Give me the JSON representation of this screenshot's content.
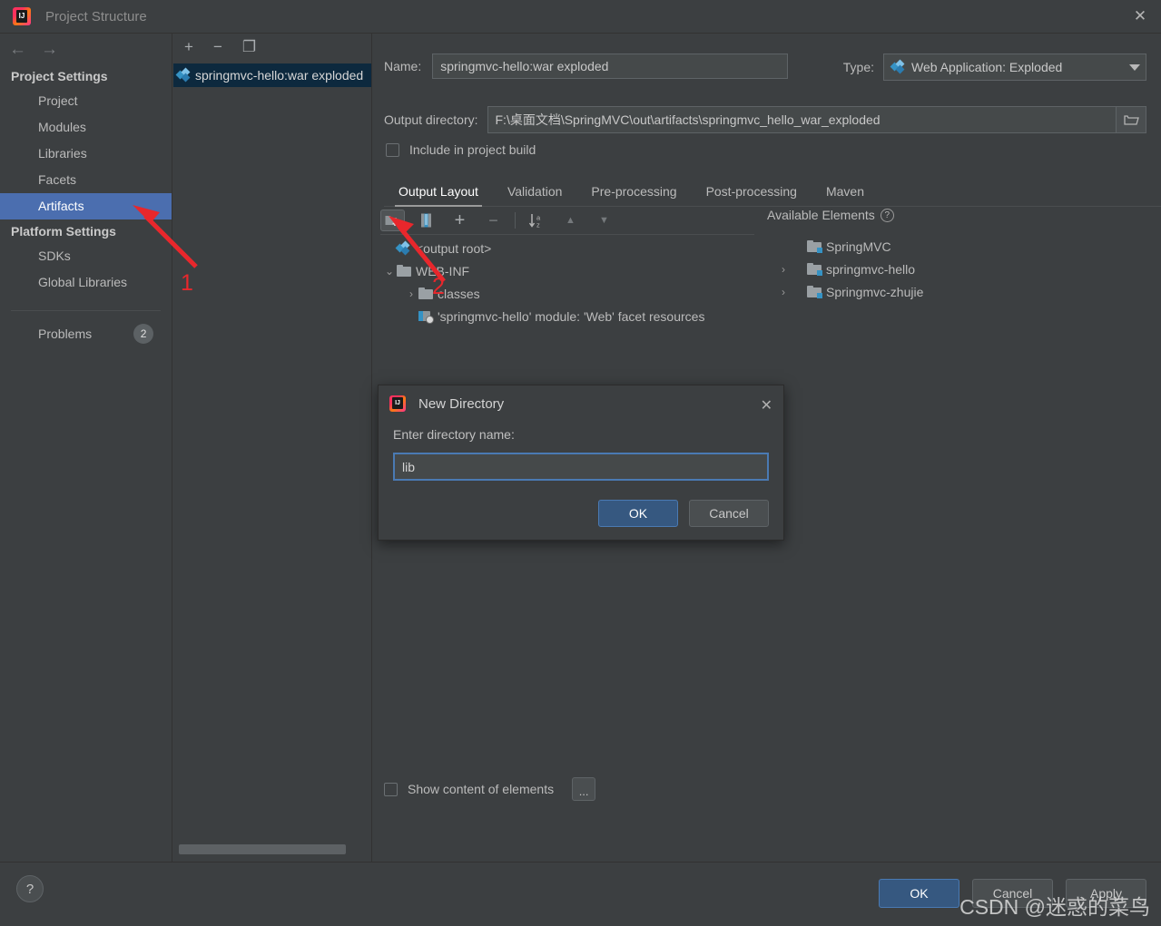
{
  "window": {
    "title": "Project Structure",
    "logo_icon": "intellij-idea-logo",
    "close_icon": "✕"
  },
  "sidebar": {
    "back_icon": "←",
    "forward_icon": "→",
    "groups": [
      {
        "title": "Project Settings",
        "items": [
          {
            "label": "Project",
            "selected": false
          },
          {
            "label": "Modules",
            "selected": false
          },
          {
            "label": "Libraries",
            "selected": false
          },
          {
            "label": "Facets",
            "selected": false
          },
          {
            "label": "Artifacts",
            "selected": true
          }
        ]
      },
      {
        "title": "Platform Settings",
        "items": [
          {
            "label": "SDKs",
            "selected": false
          },
          {
            "label": "Global Libraries",
            "selected": false
          }
        ]
      }
    ],
    "problems": {
      "label": "Problems",
      "count": "2"
    }
  },
  "artifacts_pane": {
    "toolbar": [
      {
        "name": "add-artifact-button",
        "glyph": "+"
      },
      {
        "name": "remove-artifact-button",
        "glyph": "−"
      },
      {
        "name": "copy-artifact-button",
        "glyph": "❐"
      }
    ],
    "items": [
      {
        "label": "springmvc-hello:war exploded",
        "icon": "artifact-icon",
        "selected": true
      }
    ]
  },
  "main": {
    "name_label": "Name:",
    "name_value": "springmvc-hello:war exploded",
    "type_label": "Type:",
    "type_value": "Web Application: Exploded",
    "type_icon": "web-application-icon",
    "output_dir_label": "Output directory:",
    "output_dir_value": "F:\\桌面文档\\SpringMVC\\out\\artifacts\\springmvc_hello_war_exploded",
    "browse_icon": "folder-open-icon",
    "include_in_build_label": "Include in project build",
    "include_in_build_checked": false,
    "tabs": [
      {
        "label": "Output Layout",
        "active": true
      },
      {
        "label": "Validation",
        "active": false
      },
      {
        "label": "Pre-processing",
        "active": false
      },
      {
        "label": "Post-processing",
        "active": false
      },
      {
        "label": "Maven",
        "active": false
      }
    ],
    "layout_toolbar": [
      {
        "name": "create-directory-button",
        "glyph": "",
        "pressed": true
      },
      {
        "name": "create-archive-button",
        "glyph": "",
        "pressed": false
      },
      {
        "name": "add-element-button",
        "glyph": "+",
        "pressed": false
      },
      {
        "name": "remove-element-button",
        "glyph": "−",
        "pressed": false
      },
      {
        "name": "sort-alphabetically-button",
        "glyph": "",
        "pressed": false
      },
      {
        "name": "move-up-button",
        "glyph": "▲",
        "pressed": false
      },
      {
        "name": "move-down-button",
        "glyph": "▼",
        "pressed": false
      }
    ],
    "output_tree": [
      {
        "label": "<output root>",
        "icon": "artifact-root-icon",
        "indent": 0,
        "chevron": ""
      },
      {
        "label": "WEB-INF",
        "icon": "folder-icon",
        "indent": 0,
        "chevron": "⌄"
      },
      {
        "label": "classes",
        "icon": "folder-icon",
        "indent": 1,
        "chevron": "›"
      },
      {
        "label": "'springmvc-hello' module: 'Web' facet resources",
        "icon": "facet-resources-icon",
        "indent": 1,
        "chevron": ""
      }
    ],
    "available_elements_label": "Available Elements",
    "available_help_icon": "?",
    "available_tree": [
      {
        "label": "SpringMVC",
        "icon": "module-icon",
        "chevron": ""
      },
      {
        "label": "springmvc-hello",
        "icon": "module-icon",
        "chevron": "›"
      },
      {
        "label": "Springmvc-zhujie",
        "icon": "module-icon",
        "chevron": "›"
      }
    ],
    "show_content_label": "Show content of elements",
    "show_content_checked": false,
    "dots_button_label": "..."
  },
  "dialog": {
    "title": "New Directory",
    "logo_icon": "intellij-idea-logo",
    "close_icon": "✕",
    "prompt": "Enter directory name:",
    "input_value": "lib",
    "ok_label": "OK",
    "cancel_label": "Cancel"
  },
  "footer": {
    "help_label": "?",
    "ok_label": "OK",
    "cancel_label": "Cancel",
    "apply_label": "Apply"
  },
  "annotations": {
    "marker_1": "1",
    "marker_2": "2"
  },
  "watermark": {
    "text": "CSDN @迷惑的菜鸟"
  },
  "colors": {
    "background": "#3c3f41",
    "selection_blue": "#4b6eaf",
    "accent_blue": "#3592c4",
    "primary_button": "#365880",
    "annotation_red": "#e8272c",
    "list_selection": "#0d293e"
  }
}
